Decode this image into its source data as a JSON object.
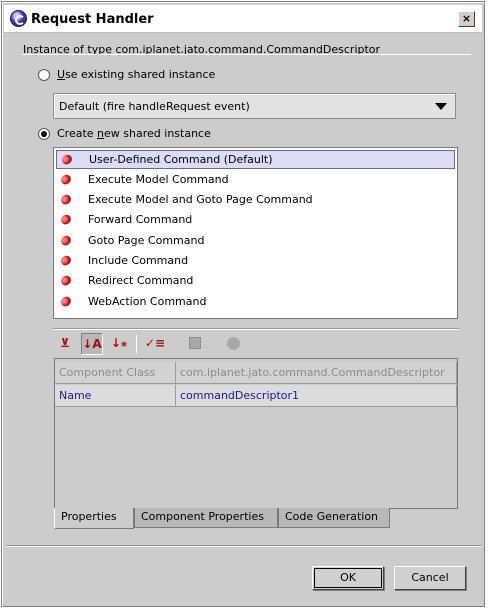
{
  "window": {
    "title": "Request Handler",
    "close_glyph": "×"
  },
  "instance_label": "Instance of type com.iplanet.jato.command.CommandDescriptor",
  "options": {
    "use_existing": {
      "label_pre": "",
      "label_mnemonic": "U",
      "label_post": "se existing shared instance",
      "checked": false
    },
    "existing_combo": {
      "value": "Default (fire handleRequest event)"
    },
    "create_new": {
      "label_pre": "Create ",
      "label_mnemonic": "n",
      "label_post": "ew shared instance",
      "checked": true
    }
  },
  "commands": [
    {
      "label": "User-Defined Command (Default)",
      "icon": "bean-icon",
      "selected": true
    },
    {
      "label": "Execute Model Command",
      "icon": "bean-icon",
      "selected": false
    },
    {
      "label": "Execute Model and Goto Page Command",
      "icon": "bean-icon",
      "selected": false
    },
    {
      "label": "Forward Command",
      "icon": "bean-icon",
      "selected": false
    },
    {
      "label": "Goto Page Command",
      "icon": "bean-icon",
      "selected": false
    },
    {
      "label": "Include Command",
      "icon": "bean-icon",
      "selected": false
    },
    {
      "label": "Redirect Command",
      "icon": "bean-icon",
      "selected": false
    },
    {
      "label": "WebAction Command",
      "icon": "bean-icon",
      "selected": false
    }
  ],
  "property_toolbar": {
    "unsorted_glyph": "⊻",
    "sort_name_glyph": "↓A",
    "sort_type_glyph": "↓⁎",
    "show_editable_glyph": "✓≡"
  },
  "properties": [
    {
      "name": "Component Class",
      "value": "com.iplanet.jato.command.CommandDescriptor",
      "readonly": true
    },
    {
      "name": "Name",
      "value": "commandDescriptor1",
      "readonly": false
    }
  ],
  "tabs": [
    {
      "label": "Properties",
      "active": true
    },
    {
      "label": "Component Properties",
      "active": false
    },
    {
      "label": "Code Generation",
      "active": false
    }
  ],
  "buttons": {
    "ok": "OK",
    "cancel": "Cancel"
  },
  "colors": {
    "dialog_bg": "#cccccc",
    "selection_bg": "#dcdcf2",
    "editable_text": "#1a1a8c",
    "bean_red": "#c01818"
  }
}
